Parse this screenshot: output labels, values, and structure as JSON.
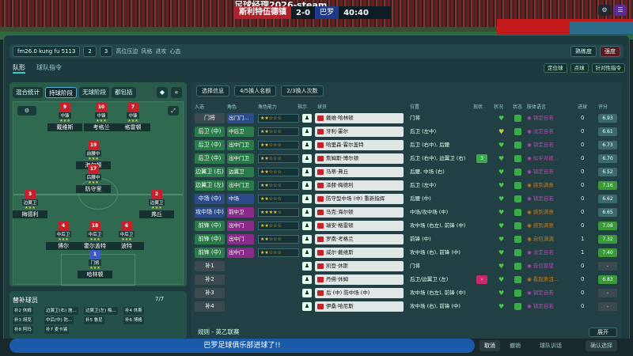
{
  "window_title": "足球经理2026-steam",
  "scoreboard": {
    "home": "斯利特伍德镇",
    "score": "2-0",
    "away": "巴罗",
    "time": "40:40"
  },
  "top_icons": [
    "gear-icon",
    "menu-icon"
  ],
  "tactics_bar": {
    "formation": "fm26.0 kung fu 5113",
    "slot1": "2",
    "slot2": "3",
    "press_label": "高位压迫",
    "style_label": "风格",
    "attack_label": "进攻",
    "mentality_label": "心态",
    "familiarity": "熟练度",
    "intensity": "强度"
  },
  "tabs": [
    "队形",
    "球队指令"
  ],
  "right_top_buttons": [
    "定位球",
    "点球",
    "针对性指令"
  ],
  "phases": [
    "混合统计",
    "持球阶段",
    "无球阶段",
    "都包括"
  ],
  "field_select": "⚙",
  "players_on_field": [
    {
      "num": "9",
      "role": "中锋",
      "name": "戴维斯",
      "stars": "★★★"
    },
    {
      "num": "10",
      "role": "中锋",
      "name": "考格兰",
      "stars": "★★★"
    },
    {
      "num": "7",
      "role": "中锋",
      "name": "格雷顿",
      "stars": "★★★"
    },
    {
      "num": "19",
      "role": "前腰中",
      "name": "海尔顿",
      "stars": "★★★"
    },
    {
      "num": "17",
      "role": "后腰中",
      "name": "防守里",
      "stars": "★★★"
    },
    {
      "num": "3",
      "role": "边翼卫",
      "name": "梅德利",
      "stars": "★★★"
    },
    {
      "num": "2",
      "role": "边翼卫",
      "name": "弗丘",
      "stars": "★★★"
    },
    {
      "num": "4",
      "role": "中后卫",
      "name": "博尔",
      "stars": "★★★"
    },
    {
      "num": "18",
      "role": "中后卫",
      "name": "霍尔盖特",
      "stars": "★★★"
    },
    {
      "num": "6",
      "role": "中后卫",
      "name": "波特",
      "stars": "★★★"
    },
    {
      "num": "1",
      "role": "门将",
      "name": "哈林顿",
      "stars": "★★★"
    }
  ],
  "subs": {
    "title": "替补球员",
    "count": "7/7",
    "chips": [
      "补2 休姆",
      "边翼卫(右) 施...",
      "边翼卫(左) 梅...",
      "补4 休斯",
      "补3 胡克",
      "中后(中) 防...",
      "补5 鲁尼",
      "补6 博格",
      "补8 阿玛",
      "补7 麦卡锡",
      "前锋 (中)"
    ]
  },
  "selection_info": "选择信息",
  "sub_stats": [
    "4/5换人名额",
    "2/3换人次数"
  ],
  "table_headers": [
    "入选",
    "角色",
    "角色能力",
    "指示",
    "球员",
    "位置",
    "现状",
    "状况",
    "状态",
    "肢体语言",
    "进球",
    "评分"
  ],
  "rows": [
    {
      "slot": "门将",
      "slot_c": "sub",
      "role": "出门门...",
      "role_c": "blue",
      "abil": "★★☆☆☆",
      "name": "戴维·哈林顿",
      "pos": "门将",
      "cond": "",
      "cond_c": "",
      "heart": "♥",
      "heart_c": "#4ac84a",
      "stat_c": "#3aaa4a",
      "lang": "◉ 镇定自若",
      "lang_c": "#b04ab0",
      "goals": "0",
      "rating": "6.93",
      "rating_c": "#3a6a6a"
    },
    {
      "slot": "后卫 (中)",
      "slot_c": "green",
      "role": "中后卫",
      "role_c": "green",
      "abil": "★★☆☆☆",
      "name": "牙利·霍尔",
      "pos": "后卫 (左中)",
      "cond": "",
      "cond_c": "",
      "heart": "♥",
      "heart_c": "#c8c84a",
      "stat_c": "#3aaa4a",
      "lang": "◉ 淡定自若",
      "lang_c": "#b04ab0",
      "goals": "0",
      "rating": "6.61",
      "rating_c": "#3a6a6a"
    },
    {
      "slot": "后卫 (中)",
      "slot_c": "green",
      "role": "出中门卫",
      "role_c": "green",
      "abil": "★★☆☆☆",
      "name": "哈里森·霍尔盖特",
      "pos": "后卫 (右中), 后腰",
      "cond": "",
      "cond_c": "",
      "heart": "♥",
      "heart_c": "#4ac84a",
      "stat_c": "#3aaa4a",
      "lang": "◉ 镇定自若",
      "lang_c": "#b04ab0",
      "goals": "0",
      "rating": "6.73",
      "rating_c": "#3a6a6a"
    },
    {
      "slot": "后卫 (中)",
      "slot_c": "green",
      "role": "出中门卫",
      "role_c": "green",
      "abil": "★★☆☆☆",
      "name": "詹姆斯·博尔顿",
      "pos": "后卫 (右中), 边翼卫 (右)",
      "cond": "3",
      "cond_c": "#3aaa4a",
      "heart": "♥",
      "heart_c": "#4ac84a",
      "stat_c": "#3aaa4a",
      "lang": "◉ 似乎对被...",
      "lang_c": "#b04ab0",
      "goals": "0",
      "rating": "6.70",
      "rating_c": "#3a6a6a"
    },
    {
      "slot": "边翼卫 (右)",
      "slot_c": "green",
      "role": "边翼卫",
      "role_c": "green",
      "abil": "★★☆☆☆",
      "name": "马蒂·弗丘",
      "pos": "后腰, 中场 (右)",
      "cond": "",
      "cond_c": "",
      "heart": "♥",
      "heart_c": "#4ac84a",
      "stat_c": "#3aaa4a",
      "lang": "◉ 镇定自若",
      "lang_c": "#b04ab0",
      "goals": "0",
      "rating": "6.52",
      "rating_c": "#3a6a6a"
    },
    {
      "slot": "边翼卫 (左)",
      "slot_c": "green",
      "role": "出中门卫",
      "role_c": "green",
      "abil": "★★☆☆☆",
      "name": "泽赫·梅德利",
      "pos": "后卫 (左中)",
      "cond": "",
      "cond_c": "",
      "heart": "♥",
      "heart_c": "#4ac84a",
      "stat_c": "#3aaa4a",
      "lang": "◉ 感到满意",
      "lang_c": "#c07a1a",
      "goals": "0",
      "rating": "7.16",
      "rating_c": "#3a9a3a"
    },
    {
      "slot": "中场 (中)",
      "slot_c": "blue",
      "role": "中场",
      "role_c": "blue",
      "abil": "★★☆☆☆",
      "name": "防守型中场 (中) 重新指挥",
      "pos": "后腰 (中)",
      "cond": "",
      "cond_c": "",
      "heart": "♥",
      "heart_c": "#4ac84a",
      "stat_c": "#3aaa4a",
      "lang": "◉ 镇定自若",
      "lang_c": "#b04ab0",
      "goals": "0",
      "rating": "6.62",
      "rating_c": "#3a6a6a"
    },
    {
      "slot": "攻中场 (中)",
      "slot_c": "blue",
      "role": "前中卫",
      "role_c": "purple",
      "abil": "★★★★☆",
      "name": "马克·海尔顿",
      "pos": "中场/攻中场 (中)",
      "cond": "",
      "cond_c": "",
      "heart": "♥",
      "heart_c": "#4ac84a",
      "stat_c": "#3aaa4a",
      "lang": "◉ 感到满意",
      "lang_c": "#c07a1a",
      "goals": "0",
      "rating": "6.65",
      "rating_c": "#3a6a6a"
    },
    {
      "slot": "前锋 (中)",
      "slot_c": "green",
      "role": "出中门",
      "role_c": "purple",
      "abil": "★★☆☆☆",
      "name": "瑞安·格雷顿",
      "pos": "攻中场 (右左), 前锋 (中)",
      "cond": "",
      "cond_c": "",
      "heart": "♥",
      "heart_c": "#4ac84a",
      "stat_c": "#3aaa4a",
      "lang": "◉ 感到满意",
      "lang_c": "#c07a1a",
      "goals": "0",
      "rating": "7.08",
      "rating_c": "#3a9a3a"
    },
    {
      "slot": "前锋 (中)",
      "slot_c": "green",
      "role": "出中门",
      "role_c": "purple",
      "abil": "★★☆☆☆",
      "name": "罗南·考格兰",
      "pos": "前锋 (中)",
      "cond": "",
      "cond_c": "",
      "heart": "♥",
      "heart_c": "#4ac84a",
      "stat_c": "#3aaa4a",
      "lang": "◉ 自信满满",
      "lang_c": "#c07a1a",
      "goals": "1",
      "rating": "7.32",
      "rating_c": "#3a9a3a"
    },
    {
      "slot": "前锋 (中)",
      "slot_c": "green",
      "role": "出中门",
      "role_c": "purple",
      "abil": "★★☆☆☆",
      "name": "威尔·戴维斯",
      "pos": "攻中场 (右), 前锋 (中)",
      "cond": "",
      "cond_c": "",
      "heart": "♥",
      "heart_c": "#4ac84a",
      "stat_c": "#3aaa4a",
      "lang": "◉ 淡定自若",
      "lang_c": "#b04ab0",
      "goals": "1",
      "rating": "7.40",
      "rating_c": "#3a9a3a"
    },
    {
      "slot": "补1",
      "slot_c": "sub",
      "role": "",
      "role_c": "",
      "abil": "",
      "name": "凯登·休斯",
      "pos": "门将",
      "cond": "",
      "cond_c": "",
      "heart": "♥",
      "heart_c": "#4ac84a",
      "stat_c": "#3aaa4a",
      "lang": "◉ 自信期望",
      "lang_c": "#b04ab0",
      "goals": "0",
      "rating": "-",
      "rating_c": "#3a4a4e"
    },
    {
      "slot": "补2",
      "slot_c": "sub",
      "role": "",
      "role_c": "",
      "abil": "",
      "name": "丹佛·休姆",
      "pos": "后卫/边翼卫 (左)",
      "cond": "‹",
      "cond_c": "#c82a6a",
      "heart": "♥",
      "heart_c": "#4ac84a",
      "stat_c": "#3aaa4a",
      "lang": "◉ 看起来沮...",
      "lang_c": "#c07a1a",
      "goals": "0",
      "rating": "6.83",
      "rating_c": "#3a9a3a"
    },
    {
      "slot": "补3",
      "slot_c": "sub",
      "role": "",
      "role_c": "",
      "abil": "",
      "name": "后 (中) 防中场 (中)",
      "pos": "攻中场 (右左), 前锋 (中)",
      "cond": "",
      "cond_c": "",
      "heart": "♥",
      "heart_c": "#4ac84a",
      "stat_c": "#3aaa4a",
      "lang": "◉ 镇定自若",
      "lang_c": "#b04ab0",
      "goals": "0",
      "rating": "-",
      "rating_c": "#3a4a4e"
    },
    {
      "slot": "补4",
      "slot_c": "sub",
      "role": "",
      "role_c": "",
      "abil": "",
      "name": "伊桑·哈尼斯",
      "pos": "攻中场 (右), 前锋 (中)",
      "cond": "",
      "cond_c": "",
      "heart": "♥",
      "heart_c": "#4ac84a",
      "stat_c": "#3aaa4a",
      "lang": "◉ 镇定自若",
      "lang_c": "#b04ab0",
      "goals": "0",
      "rating": "-",
      "rating_c": "#3a4a4e"
    }
  ],
  "competition": "规则 - 英乙联赛",
  "expand_label": "展开",
  "goal_message": "巴罗足球俱乐部进球了!!",
  "cancel_label": "取消",
  "bottom_actions": [
    "撤销",
    "球队训话",
    "确认选择"
  ]
}
